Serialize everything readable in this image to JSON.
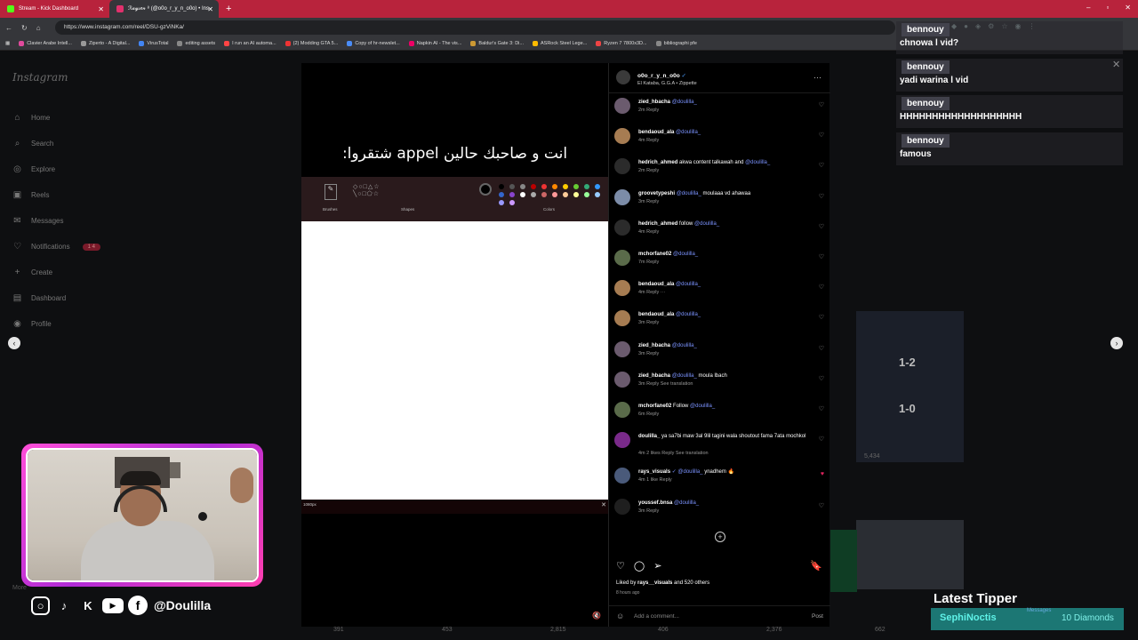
{
  "browser": {
    "tabs": [
      {
        "title": "Stream - Kick Dashboard",
        "color": "#53fc18"
      },
      {
        "title": "ℛ𝒶𝓎𝓈𝑒𝓃 ⁸ (@o0o_r_y_n_o0o) • Ins",
        "color": "#e1306c"
      }
    ],
    "new_tab": "+",
    "url": "https://www.instagram.com/reel/DSU-gzViNKa/",
    "bookmarks": [
      "Clavier Arabe Intell...",
      "Ziperto - A Digital...",
      "VirusTotal",
      "editing assets",
      "I run an AI automa...",
      "(2) Modding GTA 5...",
      "Copy of hr-newslet...",
      "Napkin AI - The vis...",
      "Baldur's Gate 3: Di...",
      "ASRock Steel Lege...",
      "Ryzen 7 7800x3D...",
      "bibliographi pfe"
    ],
    "bookmark_colors": [
      "#e04a9c",
      "#999",
      "#4285f4",
      "#888",
      "#f44",
      "#e33",
      "#4a8cf7",
      "#e06",
      "#c93",
      "#fb0",
      "#e44",
      "#888"
    ]
  },
  "instagram": {
    "logo": "Instagram",
    "nav": [
      {
        "icon": "⌂",
        "label": "Home"
      },
      {
        "icon": "⌕",
        "label": "Search"
      },
      {
        "icon": "◎",
        "label": "Explore"
      },
      {
        "icon": "▣",
        "label": "Reels"
      },
      {
        "icon": "✉",
        "label": "Messages"
      },
      {
        "icon": "♡",
        "label": "Notifications"
      },
      {
        "icon": "+",
        "label": "Create"
      },
      {
        "icon": "▤",
        "label": "Dashboard"
      },
      {
        "icon": "◉",
        "label": "Profile"
      }
    ],
    "notif_badge": "1  4",
    "more": "More",
    "bg_stats": [
      "5,434",
      "391",
      "453",
      "2,815",
      "406",
      "2,376",
      "662"
    ],
    "bg_scores": [
      "1-2",
      "1-0"
    ]
  },
  "reel": {
    "overlay_text": "انت و صاحبك حالين appel شتقروا:",
    "paint_labels": [
      "Brushes",
      "Shapes",
      "Colors"
    ],
    "resolution": "1080px",
    "swatch_colors": [
      "#000",
      "#555",
      "#888",
      "#b00",
      "#e33",
      "#f80",
      "#fc0",
      "#6c3",
      "#3a7",
      "#39f",
      "#36c",
      "#84c",
      "#fff",
      "#aaa",
      "#c66",
      "#f99",
      "#fc9",
      "#ff9",
      "#9f9",
      "#9cf",
      "#99f",
      "#c9f"
    ]
  },
  "post": {
    "author": "o0o_r_y_n_o0o",
    "verified": "✓",
    "subtitle": "El Kataba, G.G.A • Zippette",
    "more_icon": "···",
    "comments": [
      {
        "user": "zied_hbacha",
        "mention": "@doulilla_",
        "text": "",
        "meta": "2m   Reply",
        "avatar": "#6b5b6e",
        "liked": false
      },
      {
        "user": "bendaoud_ala",
        "mention": "@doulilla_",
        "text": "",
        "meta": "4m   Reply",
        "avatar": "#a67c52",
        "liked": false
      },
      {
        "user": "hedrich_ahmed",
        "mention": "",
        "text": "akwa content talkawah and",
        "mention2": "@doulilla_",
        "meta": "2m   Reply",
        "avatar": "#2b2b2b",
        "liked": false
      },
      {
        "user": "groovetypeshi",
        "mention": "@doulilla_",
        "text": "moulaaa vd ahawaa",
        "meta": "3m   Reply",
        "avatar": "#7c8ca8",
        "liked": false
      },
      {
        "user": "hedrich_ahmed",
        "mention": "",
        "text": "follow",
        "mention2": "@doulilla_",
        "meta": "4m   Reply",
        "avatar": "#2b2b2b",
        "liked": false
      },
      {
        "user": "mchorfane02",
        "mention": "@doulilla_",
        "text": "",
        "meta": "7m   Reply",
        "avatar": "#5a6b4a",
        "liked": false
      },
      {
        "user": "bendaoud_ala",
        "mention": "@doulilla_",
        "text": "",
        "meta": "4m   Reply   ···",
        "avatar": "#a67c52",
        "liked": false
      },
      {
        "user": "bendaoud_ala",
        "mention": "@doulilla_",
        "text": "",
        "meta": "3m   Reply",
        "avatar": "#a67c52",
        "liked": false
      },
      {
        "user": "zied_hbacha",
        "mention": "@doulilla_",
        "text": "",
        "meta": "3m   Reply",
        "avatar": "#6b5b6e",
        "liked": false
      },
      {
        "user": "zied_hbacha",
        "mention": "@doulilla_",
        "text": "moula lbach",
        "meta": "3m   Reply   See translation",
        "avatar": "#6b5b6e",
        "liked": false
      },
      {
        "user": "mchorfane02",
        "mention": "",
        "text": "Follow",
        "mention2": "@doulilla_",
        "meta": "6m   Reply",
        "avatar": "#5a6b4a",
        "liked": false
      },
      {
        "user": "doulilla_",
        "mention": "",
        "text": "ya sa7bi maw 3al 9lil tagini wala shoutout fama 7ata mochkol",
        "meta": "4m   2 likes   Reply   See translation",
        "avatar": "#7a2a8a",
        "liked": false
      },
      {
        "user": "rays_visuals",
        "mention": "✓ @doulilla_",
        "text": "ynadhem 🔥",
        "meta": "4m   1 like   Reply",
        "avatar": "#4a5a7a",
        "liked": true
      },
      {
        "user": "youssef.bnsa",
        "mention": "@doulilla_",
        "text": "",
        "meta": "3m   Reply",
        "avatar": "#1f1f1f",
        "liked": false
      }
    ],
    "add_icon": "+",
    "liked_by_prefix": "Liked by ",
    "liked_by_user": "rays__visuals",
    "liked_by_suffix": " and 520 others",
    "time_ago": "8 hours ago",
    "add_comment_placeholder": "Add a comment...",
    "post_button": "Post"
  },
  "chat": {
    "messages": [
      {
        "name": "bennouy",
        "message": "chnowa l vid?"
      },
      {
        "name": "bennouy",
        "message": "yadi warina l vid"
      },
      {
        "name": "bennouy",
        "message": "HHHHHHHHHHHHHHHHHHH"
      },
      {
        "name": "bennouy",
        "message": "famous"
      }
    ],
    "close_icon": "✕"
  },
  "overlay": {
    "social_handle": "@Doulilla",
    "socials": [
      "instagram-icon",
      "tiktok-icon",
      "kick-icon",
      "youtube-icon",
      "facebook-icon"
    ],
    "latest_tipper_title": "Latest Tipper",
    "tipper_name": "SephiNoctis",
    "tipper_amount": "10 Diamonds",
    "tipper_faint": "Messages"
  }
}
